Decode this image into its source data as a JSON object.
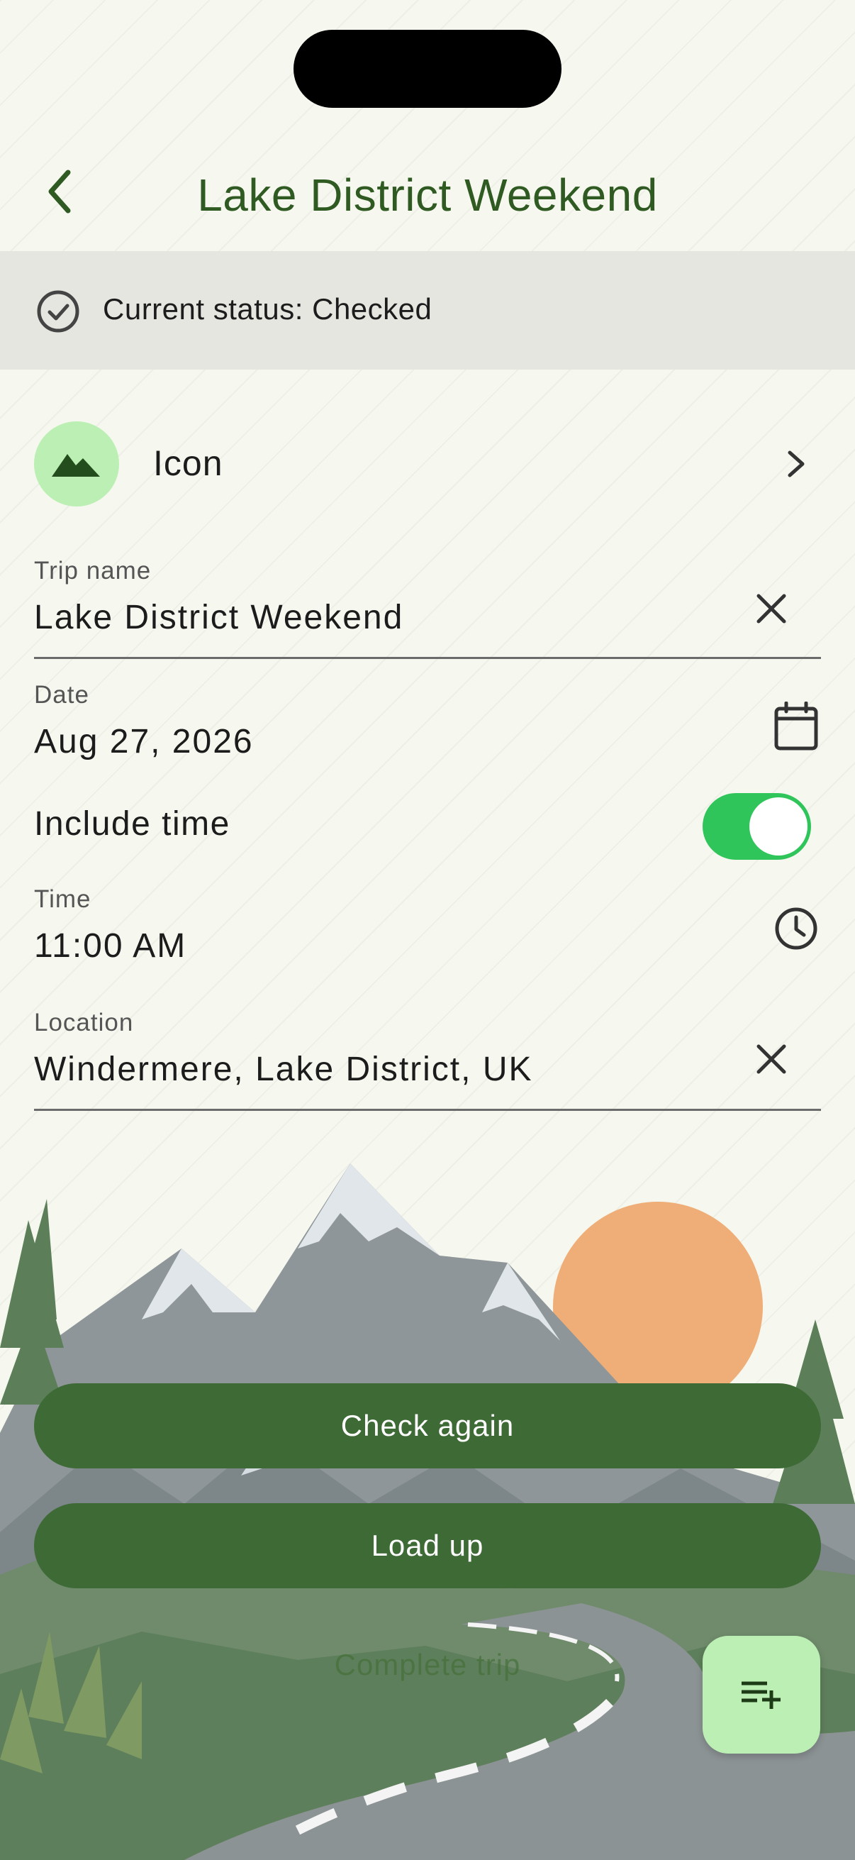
{
  "header": {
    "title": "Lake District Weekend"
  },
  "status": {
    "text": "Current status: Checked"
  },
  "icon_picker": {
    "label": "Icon",
    "icon": "mountain-icon"
  },
  "fields": {
    "trip_name": {
      "label": "Trip name",
      "value": "Lake District Weekend"
    },
    "date": {
      "label": "Date",
      "value": "Aug 27, 2026"
    },
    "include_time": {
      "label": "Include time",
      "enabled": true
    },
    "time": {
      "label": "Time",
      "value": "11:00 AM"
    },
    "location": {
      "label": "Location",
      "value": "Windermere, Lake District, UK"
    }
  },
  "actions": {
    "check_again": "Check again",
    "load_up": "Load up",
    "complete_trip": "Complete trip"
  },
  "fab": {
    "icon": "playlist-add-icon"
  },
  "colors": {
    "primary": "#3e6a36",
    "title": "#2f5a22",
    "accent_light": "#bcefb4",
    "switch_on": "#30c55a",
    "status_bg": "#e4e6df"
  }
}
